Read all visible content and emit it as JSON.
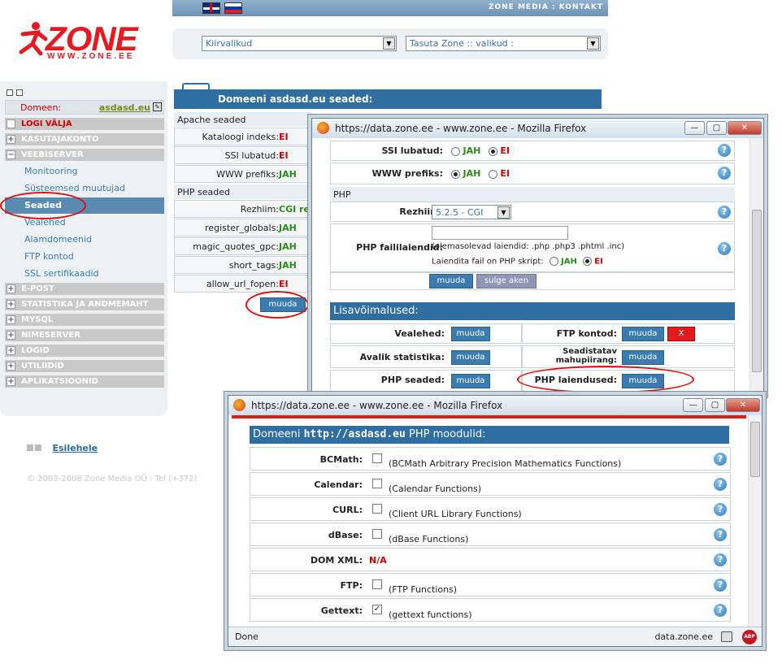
{
  "topbar": {
    "links": "ZONE MEDIA : KONTAKT",
    "flags": [
      "uk-flag-icon",
      "ru-flag-icon"
    ]
  },
  "logo": {
    "word": "ZONE",
    "url": "WWW.ZONE.EE"
  },
  "selects": {
    "quick": "Kiirvalikud",
    "free": "Tasuta Zone :: valikud :"
  },
  "sidebar": {
    "domain_label": "Domeen:",
    "domain_value": "asdasd.eu",
    "menu": [
      {
        "label": "LOGI VÄLJA",
        "red": true
      },
      {
        "label": "KASUTAJAKONTO"
      },
      {
        "label": "VEEBISERVER",
        "expanded": true
      }
    ],
    "sub": [
      "Monitooring",
      "Süsteemsed muutujad",
      "Seaded",
      "Vealehed",
      "Alamdomeenid",
      "FTP kontod",
      "SSL sertifikaadid"
    ],
    "menu2": [
      "E-POST",
      "STATISTIKA JA ANDMEMAHT",
      "MYSQL",
      "NIMESERVER",
      "LOGID",
      "UTILIIDID",
      "APLIKATSIOONID"
    ]
  },
  "footer": {
    "home": "Esilehele",
    "copyright": "© 2003-2008 Zone Media OÜ : Tel (+372)"
  },
  "panel": {
    "title": "Domeeni asdasd.eu seaded:",
    "apache_section": "Apache seaded",
    "apache": [
      {
        "k": "Kataloogi indeks:",
        "v": "EI"
      },
      {
        "k": "SSI lubatud:",
        "v": "EI"
      },
      {
        "k": "WWW prefiks:",
        "v": "JAH"
      }
    ],
    "php_section": "PHP seaded",
    "php": [
      {
        "k": "Rezhiim:",
        "v": "CGI re"
      },
      {
        "k": "register_globals:",
        "v": "JAH"
      },
      {
        "k": "magic_quotes_gpc:",
        "v": "JAH"
      },
      {
        "k": "short_tags:",
        "v": "JAH"
      },
      {
        "k": "allow_url_fopen:",
        "v": "EI"
      }
    ],
    "button": "muuda"
  },
  "win1": {
    "title": "https://data.zone.ee - www.zone.ee - Mozilla Firefox",
    "ssi_label": "SSI lubatud:",
    "www_label": "WWW prefiks:",
    "jah": "JAH",
    "ei": "EI",
    "php_header": "PHP",
    "mode_label": "Rezhiim:",
    "mode_value": "5.2.5 - CGI",
    "ext_label": "PHP faililaiendid:",
    "ext_note": "(olemasolevad laiendid: .php .php3 .phtml .inc)",
    "ext_noext": "Laiendita fail on PHP skript:",
    "save": "muuda",
    "close": "sulge aken",
    "extras_title": "Lisavõimalused:",
    "extras": [
      {
        "k": "Vealehed:",
        "b": "muuda"
      },
      {
        "k": "FTP kontod:",
        "b": "muuda",
        "x": "X"
      },
      {
        "k": "Avalik statistika:",
        "b": "muuda"
      },
      {
        "k": "Seadistatav mahupiirang:",
        "b": "muuda"
      },
      {
        "k": "PHP seaded:",
        "b": "muuda"
      },
      {
        "k": "PHP laiendused:",
        "b": "muuda"
      }
    ]
  },
  "win2": {
    "title": "https://data.zone.ee - www.zone.ee - Mozilla Firefox",
    "heading_pre": "Domeeni ",
    "heading_domain": "http://asdasd.eu",
    "heading_post": " PHP moodulid:",
    "modules": [
      {
        "k": "BCMath:",
        "desc": "(BCMath Arbitrary Precision Mathematics Functions)",
        "checked": false
      },
      {
        "k": "Calendar:",
        "desc": "(Calendar Functions)",
        "checked": false
      },
      {
        "k": "CURL:",
        "desc": "(Client URL Library Functions)",
        "checked": false
      },
      {
        "k": "dBase:",
        "desc": "(dBase Functions)",
        "checked": false
      },
      {
        "k": "DOM XML:",
        "desc": "N/A",
        "na": true
      },
      {
        "k": "FTP:",
        "desc": "(FTP Functions)",
        "checked": false
      },
      {
        "k": "Gettext:",
        "desc": "(gettext functions)",
        "checked": true
      }
    ],
    "status_left": "Done",
    "status_right": "data.zone.ee",
    "abp": "ABP"
  }
}
